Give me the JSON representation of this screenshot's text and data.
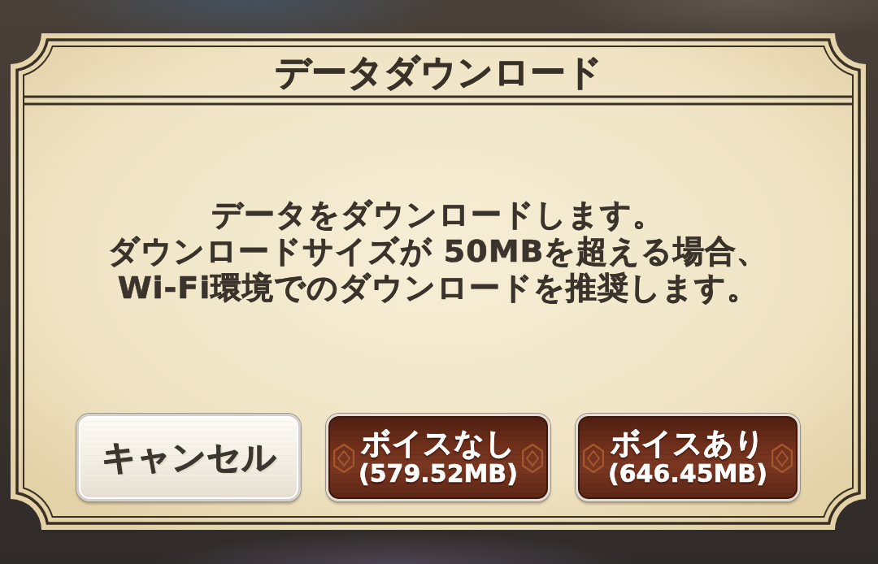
{
  "dialog": {
    "title": "データダウンロード",
    "message": [
      "データをダウンロードします。",
      "ダウンロードサイズが 50MBを超える場合、",
      "Wi-Fi環境でのダウンロードを推奨します。"
    ],
    "buttons": [
      {
        "kind": "secondary",
        "label": "キャンセル"
      },
      {
        "kind": "primary",
        "label": "ボイスなし",
        "size": "(579.52MB)"
      },
      {
        "kind": "primary",
        "label": "ボイスあり",
        "size": "(646.45MB)"
      }
    ]
  }
}
